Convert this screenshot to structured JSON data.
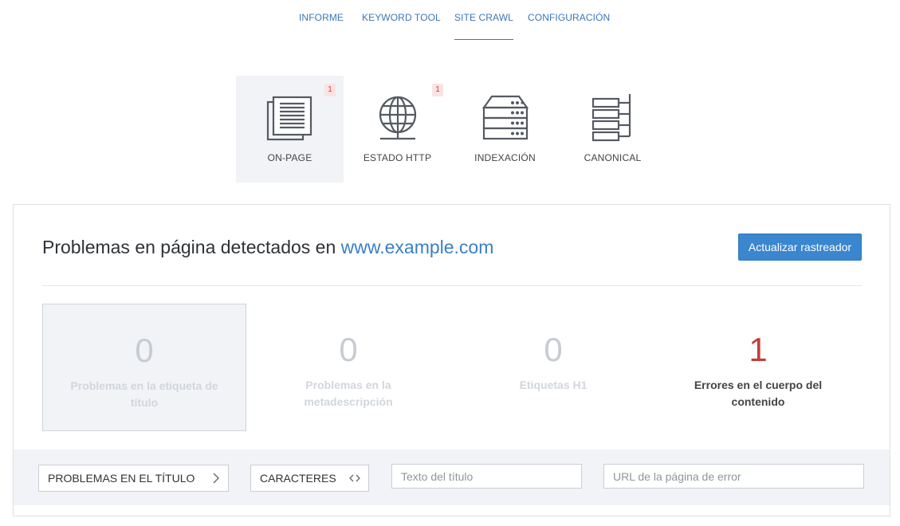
{
  "nav": {
    "items": [
      {
        "label": "INFORME",
        "active": false
      },
      {
        "label": "KEYWORD TOOL",
        "active": false
      },
      {
        "label": "SITE CRAWL",
        "active": true
      },
      {
        "label": "CONFIGURACIÓN",
        "active": false
      }
    ]
  },
  "categories": [
    {
      "label": "ON-PAGE",
      "icon": "document-stack-icon",
      "badge": "1",
      "active": true
    },
    {
      "label": "ESTADO HTTP",
      "icon": "globe-icon",
      "badge": "1",
      "active": false
    },
    {
      "label": "INDEXACIÓN",
      "icon": "server-icon",
      "badge": "",
      "active": false
    },
    {
      "label": "CANONICAL",
      "icon": "hierarchy-icon",
      "badge": "",
      "active": false
    }
  ],
  "panel": {
    "title_prefix": "Problemas en página detectados en",
    "domain": "www.example.com",
    "refresh_button": "Actualizar rastreador"
  },
  "stats": [
    {
      "value": "0",
      "label": "Problemas en la etiqueta de título",
      "selected": true
    },
    {
      "value": "0",
      "label": "Problemas en la metadescripción",
      "selected": false
    },
    {
      "value": "0",
      "label": "Etiquetas H1",
      "selected": false
    },
    {
      "value": "1",
      "label": "Errores en el cuerpo del contenido",
      "selected": false,
      "error": true
    }
  ],
  "filters": {
    "issue_type": "PROBLEMAS EN EL TÍTULO",
    "issue_type_arrow": ">",
    "characters": "CARACTERES",
    "characters_arrow": "<>",
    "title_text_placeholder": "Texto del título",
    "url_placeholder": "URL de la página de error"
  },
  "colors": {
    "accent": "#3a86cf",
    "link": "#3a76b7",
    "error": "#c0403b",
    "badge_bg": "#fbe3e3",
    "muted": "#c7ccd3",
    "tile_active_bg": "#f1f3f7"
  }
}
